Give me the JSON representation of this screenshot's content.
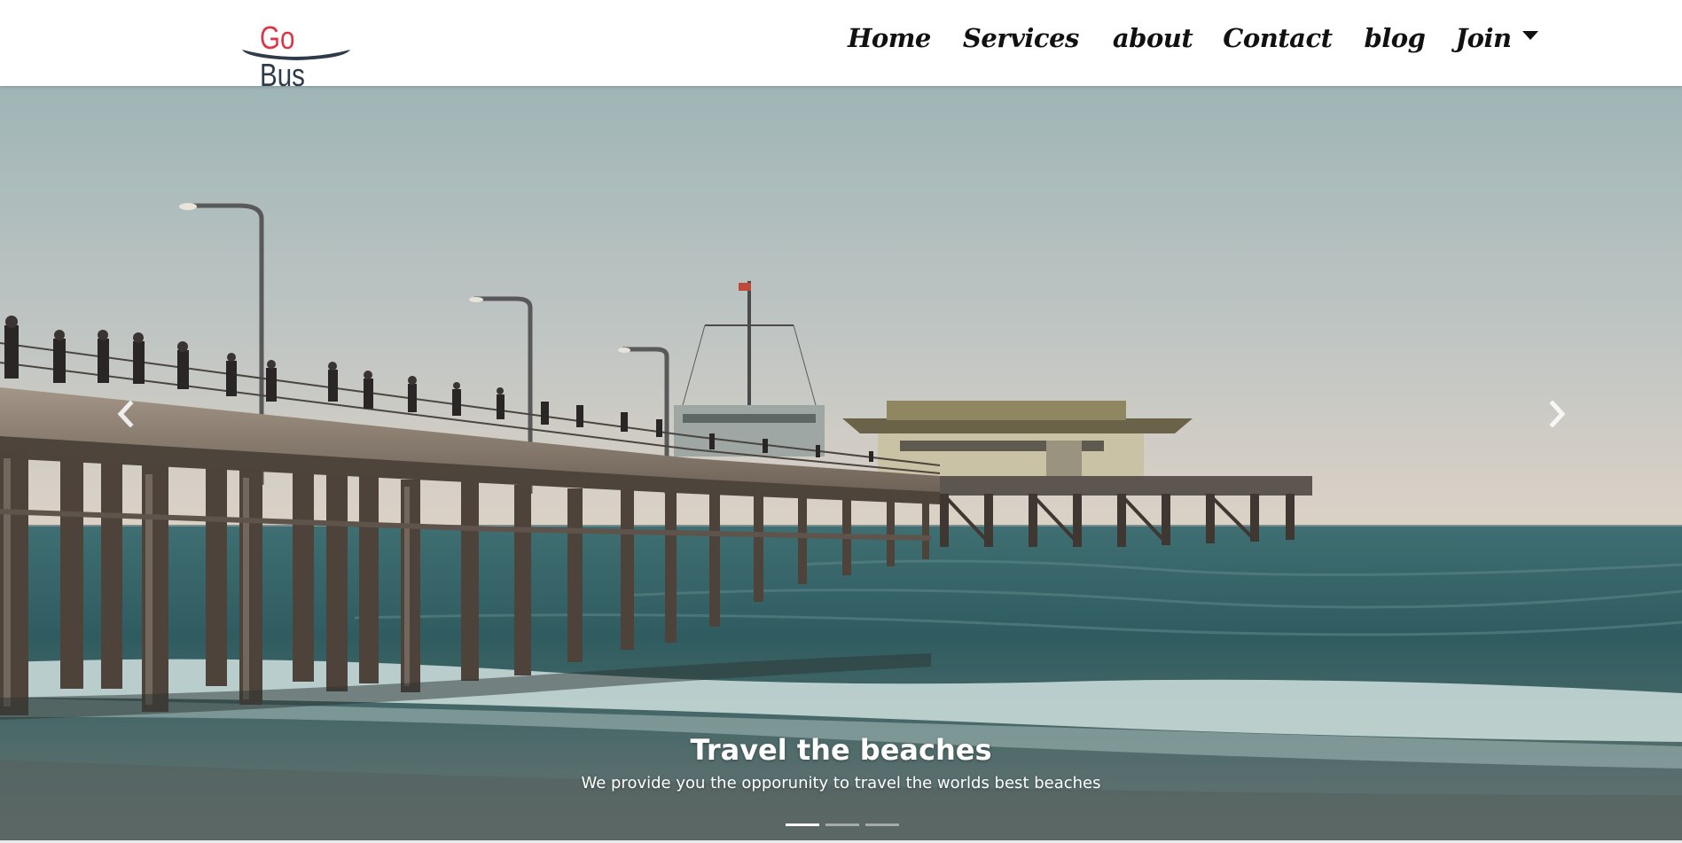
{
  "brand": {
    "part1": "Go",
    "part2": "Bus",
    "colors": {
      "go": "#dc3545",
      "bus": "#2f3a4a",
      "swoosh": "#2f3a4a"
    }
  },
  "nav": {
    "items": [
      {
        "label": "Home"
      },
      {
        "label": "Services"
      },
      {
        "label": "about"
      },
      {
        "label": "Contact"
      },
      {
        "label": "blog"
      },
      {
        "label": "Join",
        "dropdown": true,
        "icon": "caret-down-icon"
      }
    ]
  },
  "carousel": {
    "slide_count": 3,
    "active_index": 0,
    "controls": {
      "prev_icon": "chevron-left-icon",
      "next_icon": "chevron-right-icon"
    },
    "slide": {
      "image": "photo of a long wooden pier over the ocean at dusk with people along the railing",
      "title": "Travel the beaches",
      "text": "We provide you the opporunity to travel the worlds best beaches"
    }
  }
}
